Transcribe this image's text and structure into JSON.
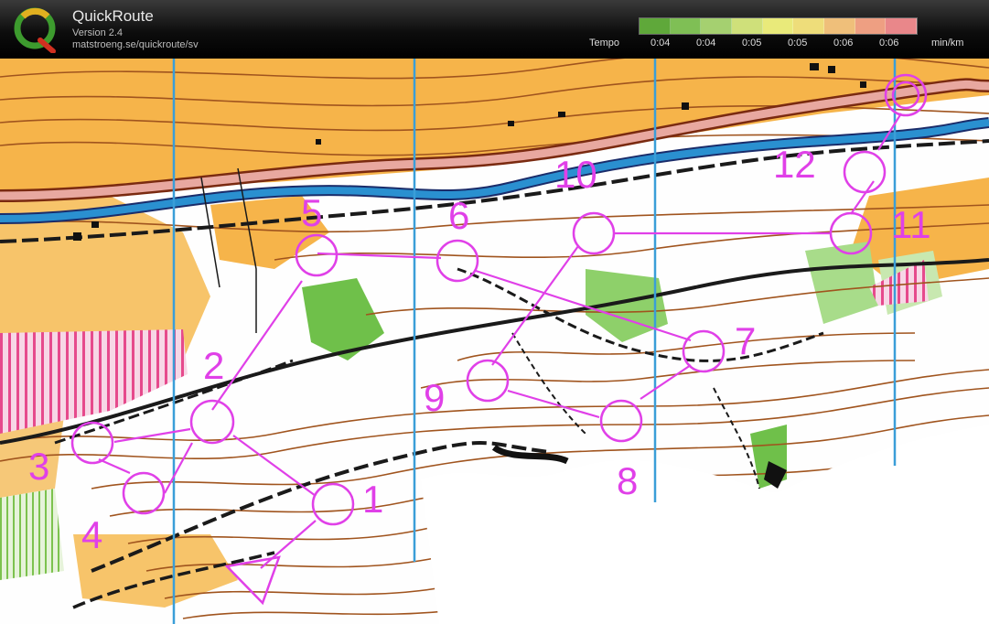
{
  "app": {
    "title": "QuickRoute",
    "version": "Version 2.4",
    "url": "matstroeng.se/quickroute/sv",
    "logo_letter": "Q"
  },
  "tempo": {
    "label": "Tempo",
    "unit": "min/km",
    "ticks": [
      "0:04",
      "0:04",
      "0:05",
      "0:05",
      "0:06",
      "0:06"
    ],
    "colors": [
      "#5fa83a",
      "#7fbf55",
      "#a5d070",
      "#cfe07a",
      "#e9ea7a",
      "#eedd7a",
      "#efbf7a",
      "#ee9f82",
      "#e9878a"
    ]
  },
  "map": {
    "course_color": "#e040e8",
    "north_line_color": "#3a9ed8",
    "controls": [
      {
        "number": "1"
      },
      {
        "number": "2"
      },
      {
        "number": "3"
      },
      {
        "number": "4"
      },
      {
        "number": "5"
      },
      {
        "number": "6"
      },
      {
        "number": "7"
      },
      {
        "number": "8"
      },
      {
        "number": "9"
      },
      {
        "number": "10"
      },
      {
        "number": "11"
      },
      {
        "number": "12"
      }
    ]
  }
}
